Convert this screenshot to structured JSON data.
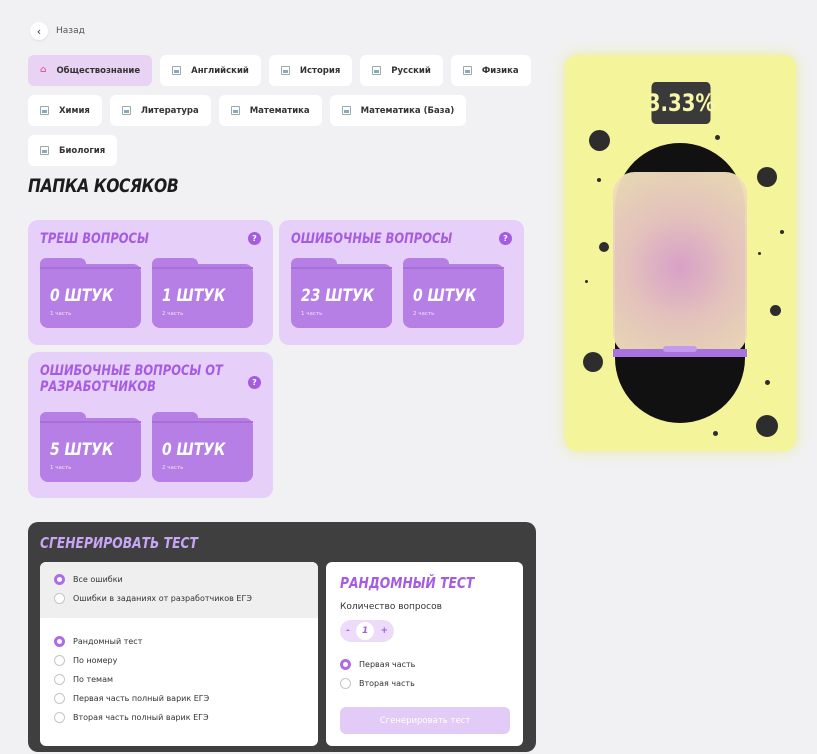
{
  "back": {
    "label": "Назад"
  },
  "subjects": [
    {
      "label": "Обществознание",
      "active": true
    },
    {
      "label": "Английский",
      "active": false
    },
    {
      "label": "История",
      "active": false
    },
    {
      "label": "Русский",
      "active": false
    },
    {
      "label": "Физика",
      "active": false
    },
    {
      "label": "Химия",
      "active": false
    },
    {
      "label": "Литература",
      "active": false
    },
    {
      "label": "Математика",
      "active": false
    },
    {
      "label": "Математика (База)",
      "active": false
    },
    {
      "label": "Биология",
      "active": false
    }
  ],
  "page_title": "ПАПКА КОСЯКОВ",
  "cards": {
    "trash": {
      "title": "ТРЕШ ВОПРОСЫ",
      "help": "?",
      "folders": [
        {
          "count": "0 ШТУК",
          "part": "1 часть"
        },
        {
          "count": "1 ШТУК",
          "part": "2 часть"
        }
      ]
    },
    "wrong": {
      "title": "ОШИБОЧНЫЕ ВОПРОСЫ",
      "help": "?",
      "folders": [
        {
          "count": "23 ШТУК",
          "part": "1 часть"
        },
        {
          "count": "0 ШТУК",
          "part": "2 часть"
        }
      ]
    },
    "dev": {
      "title_line1": "ОШИБОЧНЫЕ ВОПРОСЫ ОТ",
      "title_line2": "РАЗРАБОТЧИКОВ",
      "help": "?",
      "folders": [
        {
          "count": "5 ШТУК",
          "part": "1 часть"
        },
        {
          "count": "0 ШТУК",
          "part": "2 часть"
        }
      ]
    }
  },
  "generate": {
    "title": "СГЕНЕРИРОВАТЬ ТЕСТ",
    "source_options": [
      {
        "label": "Все ошибки",
        "selected": true
      },
      {
        "label": "Ошибки в заданиях от разработчиков ЕГЭ",
        "selected": false
      }
    ],
    "mode_options": [
      {
        "label": "Рандомный тест",
        "selected": true
      },
      {
        "label": "По номеру",
        "selected": false
      },
      {
        "label": "По темам",
        "selected": false
      },
      {
        "label": "Первая часть полный варик ЕГЭ",
        "selected": false
      },
      {
        "label": "Вторая часть полный варик ЕГЭ",
        "selected": false
      }
    ],
    "random": {
      "title": "РАНДОМНЫЙ ТЕСТ",
      "count_label": "Количество вопросов",
      "minus": "-",
      "value": "1",
      "plus": "+",
      "part_options": [
        {
          "label": "Первая часть",
          "selected": true
        },
        {
          "label": "Вторая часть",
          "selected": false
        }
      ],
      "button": "Сгенерировать тест"
    }
  },
  "progress": {
    "percent_label": "3.33%",
    "value": 0.0333
  },
  "colors": {
    "accent": "#a55ce0",
    "card_bg": "#e6cff8",
    "folder": "#b67fe6",
    "panel_yellow": "#f4f59a",
    "dark": "#3f3f3f"
  }
}
